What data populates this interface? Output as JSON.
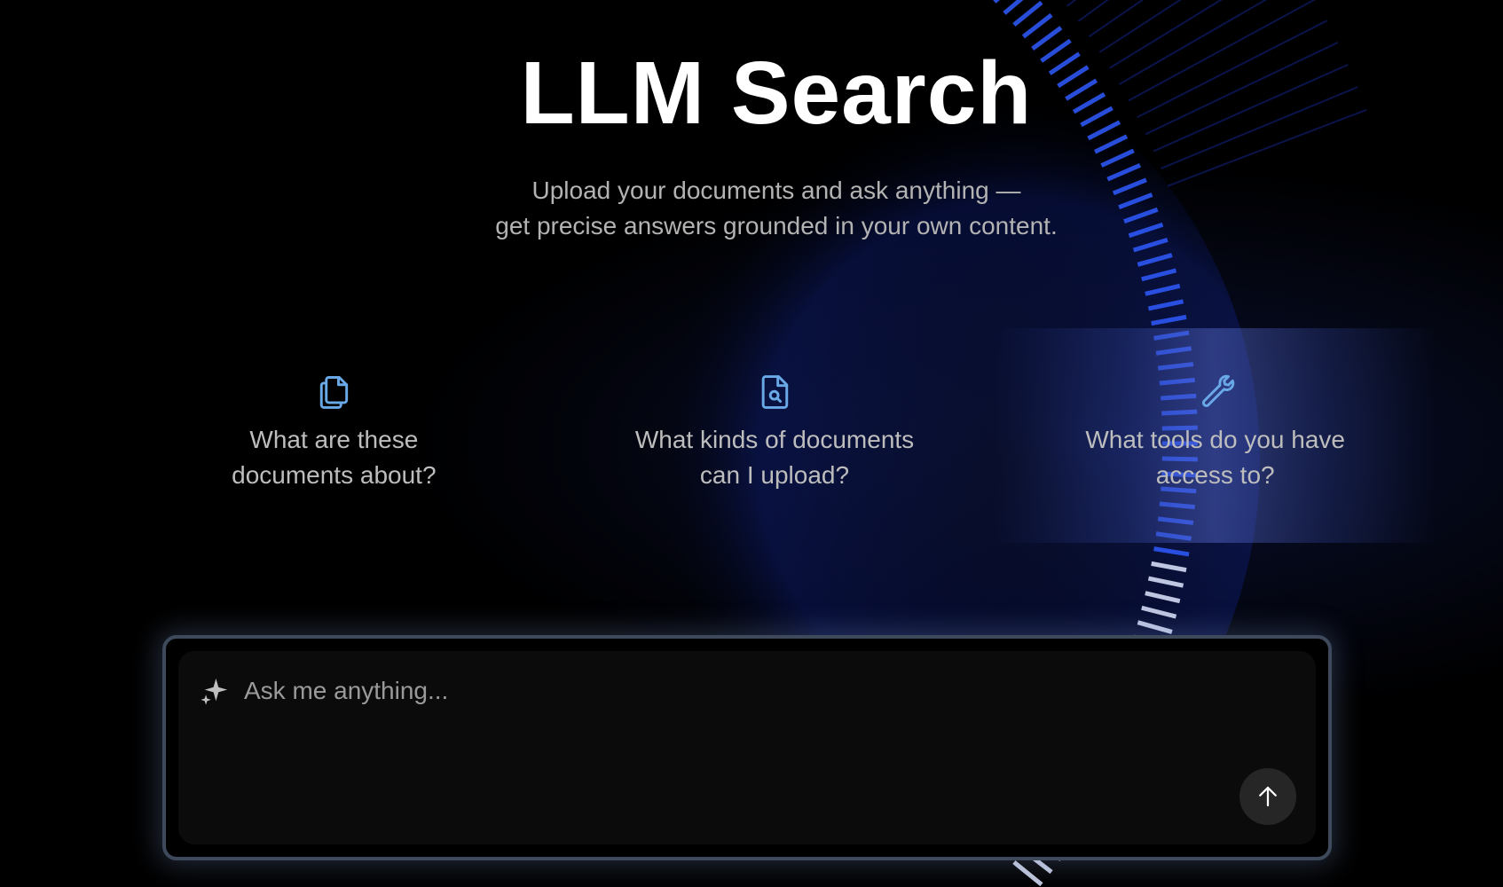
{
  "header": {
    "title": "LLM Search",
    "subtitle_line1": "Upload your documents and ask anything —",
    "subtitle_line2": "get precise answers grounded in your own content."
  },
  "suggestions": [
    {
      "icon": "documents-icon",
      "line1": "What are these",
      "line2": "documents about?"
    },
    {
      "icon": "file-search-icon",
      "line1": "What kinds of documents",
      "line2": "can I upload?"
    },
    {
      "icon": "wrench-icon",
      "line1": "What tools do you have",
      "line2": "access to?"
    }
  ],
  "chat_input": {
    "placeholder": "Ask me anything..."
  },
  "colors": {
    "accent": "#6aa9e8",
    "glow": "#2b5cff",
    "background": "#000000"
  }
}
